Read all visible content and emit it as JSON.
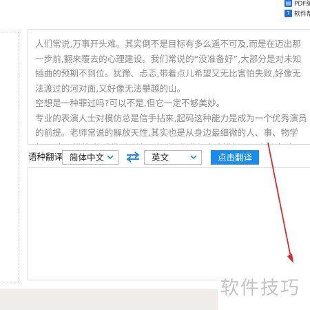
{
  "toplinks": [
    {
      "label": "PDF编",
      "icon": "pdf-icon",
      "color": "#1e6fd9",
      "glyph": "▤"
    },
    {
      "label": "软件帮",
      "icon": "help-icon",
      "color": "#1e6fd9",
      "glyph": "?"
    }
  ],
  "source": {
    "paragraphs": [
      "人们常说,万事开头难。其实倒不是目标有多么遥不可及,而是在迈出那一步前,翻来覆去的心理建设。我们常说的“没准备好”,大部分是对未知插曲的预期不到位。犹豫、忐忑,带着点儿希望又无比害怕失败,好像无法渡过的河对面,又好像无法攀越的山。",
      "空想是一种罪过吗?可以不是,但它一定不够美妙。",
      "专业的表演人士对模仿总是信手拈来,起码这种能力是成为一个优秀演员的前提。老师常说的解放天性,其实也是从身边最细微的人、事、物学起,观察、模仿,然后得到反馈。小时候的我很喜欢模拟不同身份,把自己代入不同情境,完全"
    ]
  },
  "translate_bar": {
    "label": "语种翻译:",
    "source_lang": "简体中文",
    "target_lang": "英文",
    "button": "点击翻译"
  },
  "watermark": "软件技巧",
  "colors": {
    "accent": "#1a8cf0",
    "annotation": "#e0262b"
  }
}
